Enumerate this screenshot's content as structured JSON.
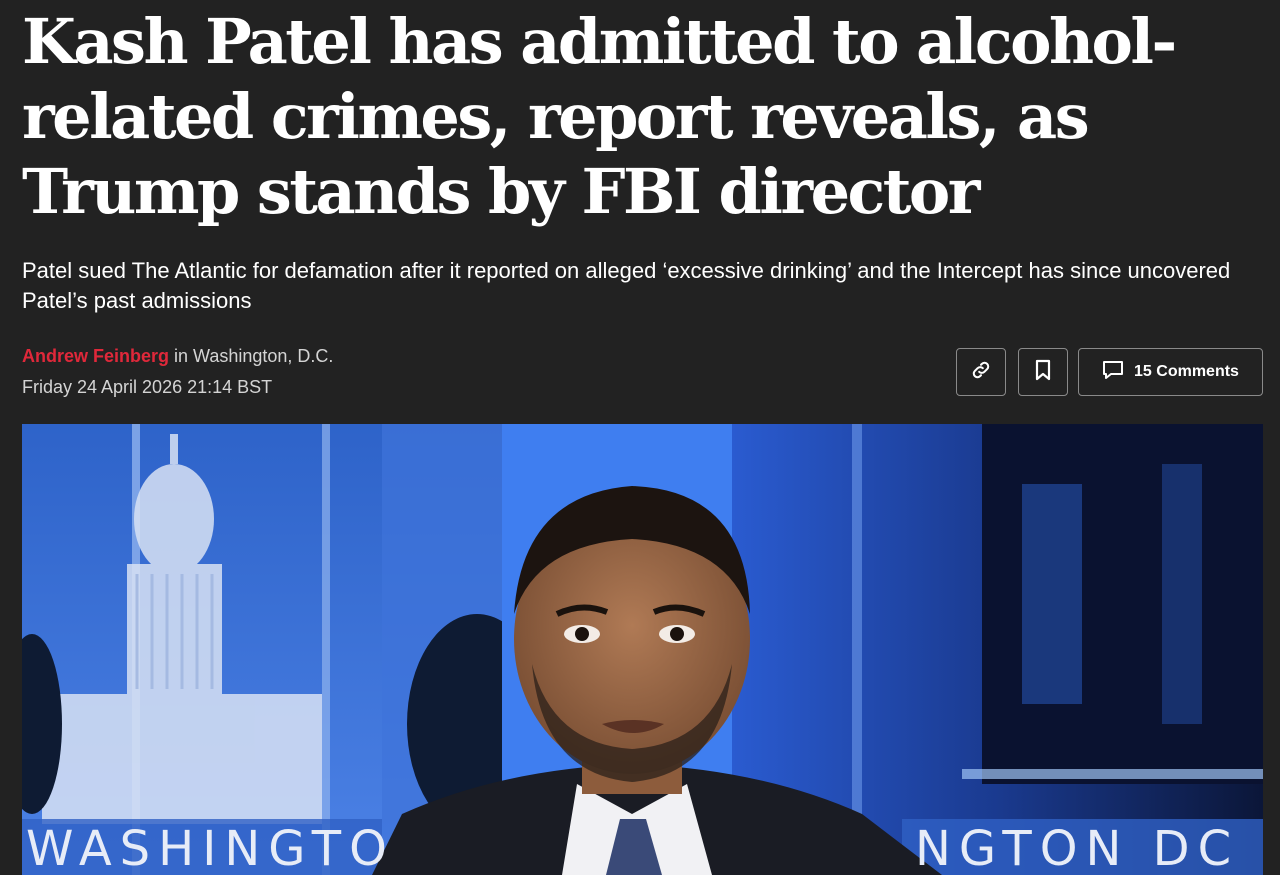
{
  "article": {
    "headline": "Kash Patel has admitted to alcohol-related crimes, report reveals, as Trump stands by FBI director",
    "standfirst": "Patel sued The Atlantic for defamation after it reported on alleged ‘excessive drinking’ and the Intercept has since uncovered Patel’s past admissions",
    "author": "Andrew Feinberg",
    "location": "in Washington, D.C.",
    "date": "Friday 24 April 2026 21:14 BST"
  },
  "actions": {
    "link_icon": "link-icon",
    "bookmark_icon": "bookmark-icon",
    "comment_icon": "comment-icon",
    "comments_label": "15 Comments"
  },
  "hero": {
    "caption_left": "WASHINGTO",
    "caption_right": "NGTON DC"
  },
  "colors": {
    "background": "#222222",
    "author_red": "#e0283a",
    "text": "#ffffff",
    "meta_text": "#d4d4d4"
  }
}
